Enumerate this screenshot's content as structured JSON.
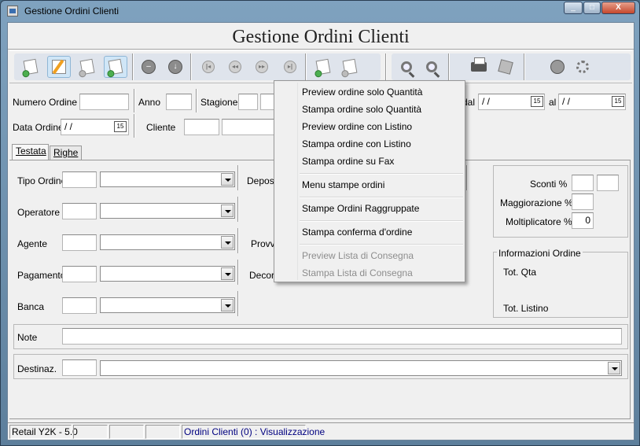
{
  "window": {
    "title": "Gestione Ordini Clienti",
    "minimize": "_",
    "maximize": "□",
    "close": "X"
  },
  "header": {
    "title": "Gestione Ordini Clienti"
  },
  "toolbar": {
    "icons": [
      "new-order-icon",
      "edit-icon",
      "copy-icon",
      "refresh-icon",
      "cancel-icon",
      "save-icon",
      "first-icon",
      "prev-icon",
      "next-icon",
      "last-icon",
      "attach-icon",
      "detach-icon",
      "search-icon",
      "zoom-icon",
      "print-icon",
      "export-icon",
      "help-icon",
      "tools-icon"
    ]
  },
  "top_fields": {
    "numero_ordine_label": "Numero Ordine",
    "anno_label": "Anno",
    "stagione_label": "Stagione",
    "dal_label": "dal",
    "dal_value": "/ /",
    "al_label": "al",
    "al_value": "/ /",
    "data_ordine_label": "Data Ordine",
    "data_ordine_value": "/ /",
    "cliente_label": "Cliente",
    "cal_glyph": "15"
  },
  "tabs": [
    {
      "label": "Testata",
      "active": true
    },
    {
      "label": "Righe",
      "active": false
    }
  ],
  "form": {
    "tipo_ordine": "Tipo Ordine",
    "operatore": "Operatore",
    "agente": "Agente",
    "pagamento": "Pagamento",
    "banca": "Banca",
    "note": "Note",
    "destinaz": "Destinaz.",
    "deposito": "Deposi",
    "provvigioni": "Provvi",
    "decorrenza": "Decorr"
  },
  "sconti_panel": {
    "sconti": "Sconti %",
    "maggiorazione": "Maggiorazione %",
    "moltiplicatore": "Moltiplicatore %",
    "moltiplicatore_value": "0"
  },
  "info_panel": {
    "title": "Informazioni Ordine",
    "tot_qta": "Tot. Qta",
    "tot_listino": "Tot. Listino"
  },
  "context_menu": {
    "items": [
      {
        "label": "Preview ordine solo Quantità",
        "enabled": true
      },
      {
        "label": "Stampa ordine solo Quantità",
        "enabled": true
      },
      {
        "label": "Preview ordine con Listino",
        "enabled": true
      },
      {
        "label": "Stampa ordine con Listino",
        "enabled": true
      },
      {
        "label": "Stampa ordine su Fax",
        "enabled": true
      },
      {
        "label": "Menu stampe ordini",
        "enabled": true
      },
      {
        "label": "Stampe Ordini Raggruppate",
        "enabled": true
      },
      {
        "label": "Stampa conferma d'ordine",
        "enabled": true
      },
      {
        "label": "Preview Lista di Consegna",
        "enabled": false
      },
      {
        "label": "Stampa Lista di Consegna",
        "enabled": false
      }
    ]
  },
  "statusbar": {
    "version": "Retail Y2K - 5.0",
    "status": "Ordini Clienti (0) : Visualizzazione"
  }
}
